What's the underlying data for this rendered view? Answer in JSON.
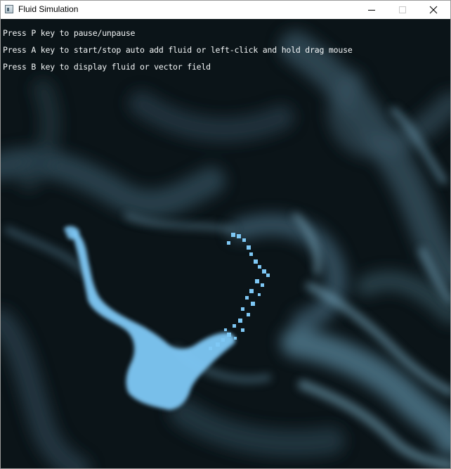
{
  "window": {
    "title": "Fluid Simulation",
    "icon": "app-window-icon"
  },
  "controls": {
    "minimize_icon": "minimize-icon",
    "maximize_icon": "maximize-icon",
    "close_icon": "close-icon"
  },
  "instructions": [
    "Press P key to pause/unpause",
    "Press A key to start/stop auto add fluid or left-click and hold drag mouse",
    "Press B key to display fluid or vector field"
  ],
  "colors": {
    "background": "#0b1418",
    "fluid": "#7ec8f5",
    "smoke": "#5f8ca3",
    "text": "#f3f6f7"
  }
}
